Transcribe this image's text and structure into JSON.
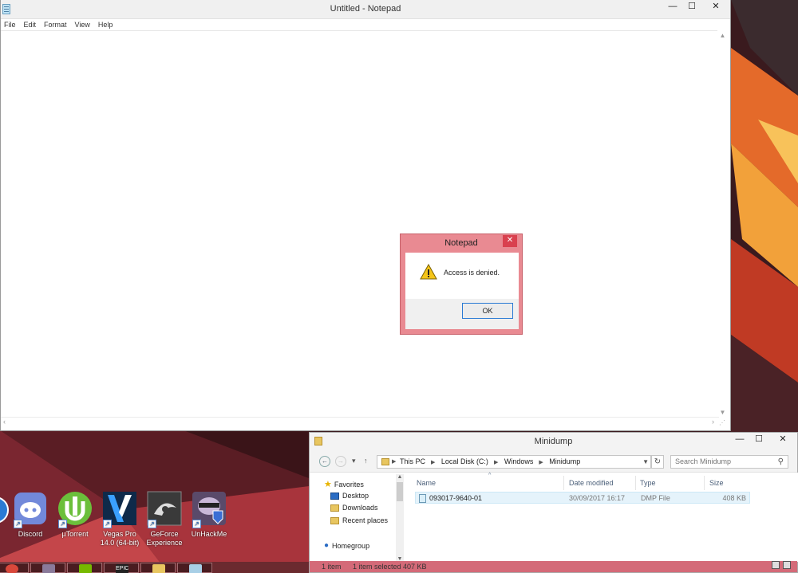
{
  "notepad": {
    "title": "Untitled - Notepad",
    "menu": [
      "File",
      "Edit",
      "Format",
      "View",
      "Help"
    ],
    "minimize": "—",
    "maximize": "☐",
    "close": "✕"
  },
  "dialog": {
    "title": "Notepad",
    "close": "✕",
    "message": "Access is denied.",
    "ok_label": "OK"
  },
  "desktop_icons": [
    {
      "label": "Discord",
      "color": "#7289da"
    },
    {
      "label": "µTorrent",
      "color": "#6bbf3b"
    },
    {
      "label": "Vegas Pro 14.0 (64-bit)",
      "color": "#1d6fc1"
    },
    {
      "label": "GeForce Experience",
      "color": "#3a3a3a"
    },
    {
      "label": "UnHackMe",
      "color": "#6c5a7e"
    }
  ],
  "explorer": {
    "title": "Minidump",
    "minimize": "—",
    "maximize": "☐",
    "close": "✕",
    "breadcrumb": [
      "This PC",
      "Local Disk (C:)",
      "Windows",
      "Minidump"
    ],
    "search_placeholder": "Search Minidump",
    "nav": {
      "favorites": "Favorites",
      "desktop": "Desktop",
      "downloads": "Downloads",
      "recent": "Recent places",
      "homegroup": "Homegroup"
    },
    "columns": {
      "name": "Name",
      "date": "Date modified",
      "type": "Type",
      "size": "Size"
    },
    "files": [
      {
        "name": "093017-9640-01",
        "date": "30/09/2017 16:17",
        "type": "DMP File",
        "size": "408 KB"
      }
    ],
    "status": {
      "count": "1 item",
      "selected": "1 item selected  407 KB"
    }
  },
  "taskbar": {
    "items": [
      {
        "name": "chrome",
        "color": "#d9483b"
      },
      {
        "name": "unhackme",
        "color": "#8a7a9a"
      },
      {
        "name": "nvidia",
        "color": "#76b900"
      },
      {
        "name": "epic",
        "color": "#222222"
      },
      {
        "name": "explorer",
        "color": "#e8c660"
      },
      {
        "name": "notepad",
        "color": "#a8cfe6"
      }
    ],
    "epic_label": "EPIC"
  }
}
